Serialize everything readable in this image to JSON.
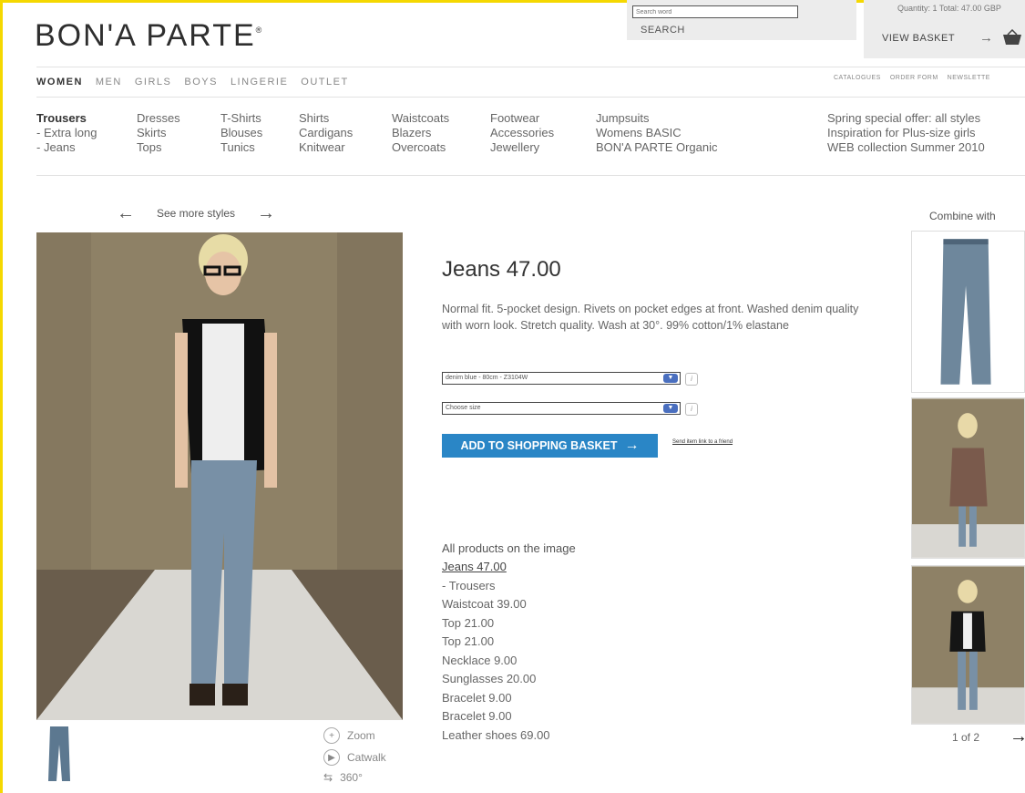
{
  "brand": {
    "logo": "BON'A PARTE",
    "mark": "®"
  },
  "search": {
    "placeholder": "Search word",
    "button": "SEARCH"
  },
  "basket": {
    "summary": "Quantity: 1  Total: 47.00 GBP",
    "view_label": "VIEW BASKET",
    "arrow": "→"
  },
  "nav": {
    "items": [
      "WOMEN",
      "MEN",
      "GIRLS",
      "BOYS",
      "LINGERIE",
      "OUTLET"
    ],
    "active": "WOMEN",
    "right_links": [
      "CATALOGUES",
      "ORDER FORM",
      "NEWSLETTE"
    ]
  },
  "categories": {
    "col1": [
      "Trousers",
      "- Extra long",
      "- Jeans"
    ],
    "col2": [
      "Dresses",
      "Skirts",
      "Tops"
    ],
    "col3": [
      "T-Shirts",
      "Blouses",
      "Tunics"
    ],
    "col4": [
      "Shirts",
      "Cardigans",
      "Knitwear"
    ],
    "col5": [
      "Waistcoats",
      "Blazers",
      "Overcoats"
    ],
    "col6": [
      "Footwear",
      "Accessories",
      "Jewellery"
    ],
    "col7": [
      "Jumpsuits",
      "Womens BASIC",
      "BON'A PARTE Organic"
    ],
    "col8": [
      "Spring special offer: all styles",
      "Inspiration for Plus-size girls",
      "WEB collection Summer 2010"
    ]
  },
  "browse": {
    "prev": "←",
    "label": "See more styles",
    "next": "→"
  },
  "tools": {
    "zoom": "Zoom",
    "catwalk": "Catwalk",
    "rotate": "360°"
  },
  "product": {
    "title": "Jeans 47.00",
    "description": "Normal fit. 5-pocket design. Rivets on pocket edges at front. Washed denim quality with worn look. Stretch quality. Wash at 30°. 99% cotton/1% elastane",
    "color_select": "denim blue - 80cm - Z3104W",
    "size_select": "Choose size",
    "add_button": "ADD TO SHOPPING BASKET",
    "add_arrow": "→",
    "send_link": "Send item link to a friend",
    "info_icon": "i"
  },
  "all_products": {
    "heading": "All products on the image",
    "items": [
      "Jeans 47.00",
      " - Trousers",
      "Waistcoat 39.00",
      "Top 21.00",
      "Top 21.00",
      "Necklace 9.00",
      "Sunglasses 20.00",
      "Bracelet 9.00",
      "Bracelet 9.00",
      "Leather shoes 69.00"
    ]
  },
  "combine": {
    "label": "Combine with",
    "pager": "1 of 2",
    "arrow": "→"
  },
  "colors": {
    "accent": "#2a86c6",
    "frame": "#f5d800",
    "backdrop": "#8e8166",
    "runway": "#d9d7d2",
    "floor": "#6a5d4c"
  }
}
